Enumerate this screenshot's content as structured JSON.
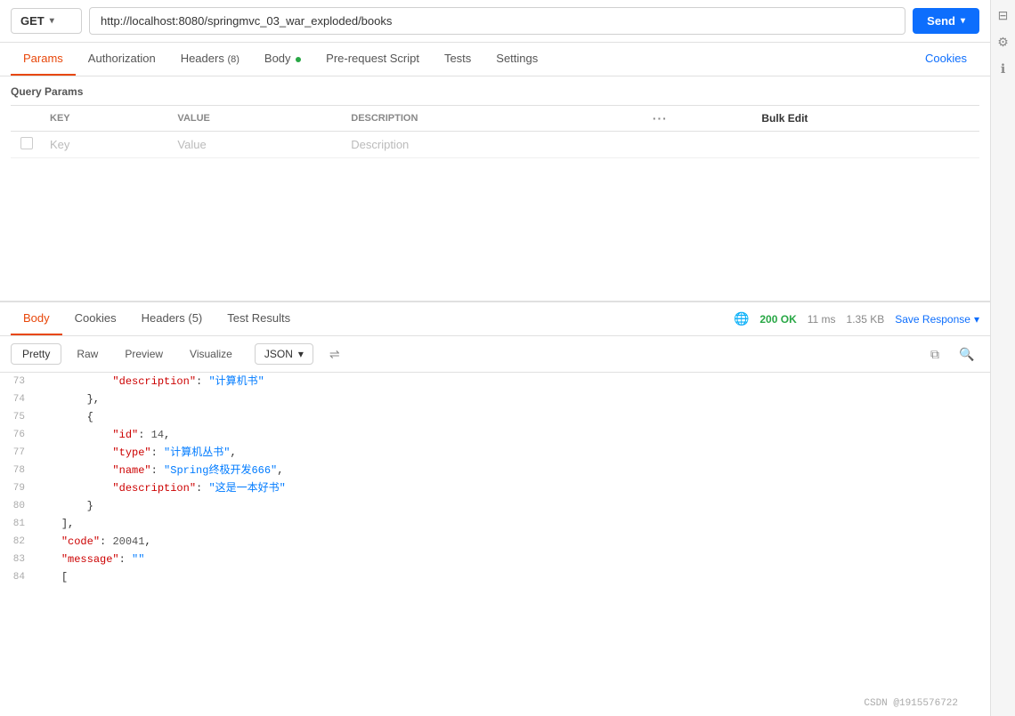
{
  "url_bar": {
    "method": "GET",
    "url": "http://localhost:8080/springmvc_03_war_exploded/books",
    "send_label": "Send"
  },
  "request_tabs": [
    {
      "id": "params",
      "label": "Params",
      "active": true
    },
    {
      "id": "authorization",
      "label": "Authorization",
      "active": false
    },
    {
      "id": "headers",
      "label": "Headers",
      "badge": "(8)",
      "active": false
    },
    {
      "id": "body",
      "label": "Body",
      "dot": true,
      "active": false
    },
    {
      "id": "pre-request",
      "label": "Pre-request Script",
      "active": false
    },
    {
      "id": "tests",
      "label": "Tests",
      "active": false
    },
    {
      "id": "settings",
      "label": "Settings",
      "active": false
    },
    {
      "id": "cookies",
      "label": "Cookies",
      "right": true,
      "active": false
    }
  ],
  "query_params": {
    "title": "Query Params",
    "columns": [
      "KEY",
      "VALUE",
      "DESCRIPTION"
    ],
    "key_placeholder": "Key",
    "value_placeholder": "Value",
    "description_placeholder": "Description",
    "bulk_edit_label": "Bulk Edit"
  },
  "response_tabs": [
    {
      "id": "body",
      "label": "Body",
      "active": true
    },
    {
      "id": "cookies",
      "label": "Cookies",
      "active": false
    },
    {
      "id": "headers",
      "label": "Headers",
      "badge": "(5)",
      "active": false
    },
    {
      "id": "test-results",
      "label": "Test Results",
      "active": false
    }
  ],
  "response_status": {
    "status": "200 OK",
    "time": "11 ms",
    "size": "1.35 KB",
    "save_label": "Save Response"
  },
  "format_bar": {
    "buttons": [
      "Pretty",
      "Raw",
      "Preview",
      "Visualize"
    ],
    "active_button": "Pretty",
    "format": "JSON"
  },
  "code_lines": [
    {
      "num": 73,
      "content": "            \"description\": \"计算机书\""
    },
    {
      "num": 74,
      "content": "        },"
    },
    {
      "num": 75,
      "content": "        {"
    },
    {
      "num": 76,
      "content": "            \"id\": 14,"
    },
    {
      "num": 77,
      "content": "            \"type\": \"计算机丛书\","
    },
    {
      "num": 78,
      "content": "            \"name\": \"Spring终极开发666\","
    },
    {
      "num": 79,
      "content": "            \"description\": \"这是一本好书\""
    },
    {
      "num": 80,
      "content": "        }"
    },
    {
      "num": 81,
      "content": "    ],"
    },
    {
      "num": 82,
      "content": "    \"code\": 20041,"
    },
    {
      "num": 83,
      "content": "    \"message\": \"\""
    },
    {
      "num": 84,
      "content": "["
    }
  ],
  "watermark": "CSDN @1915576722"
}
